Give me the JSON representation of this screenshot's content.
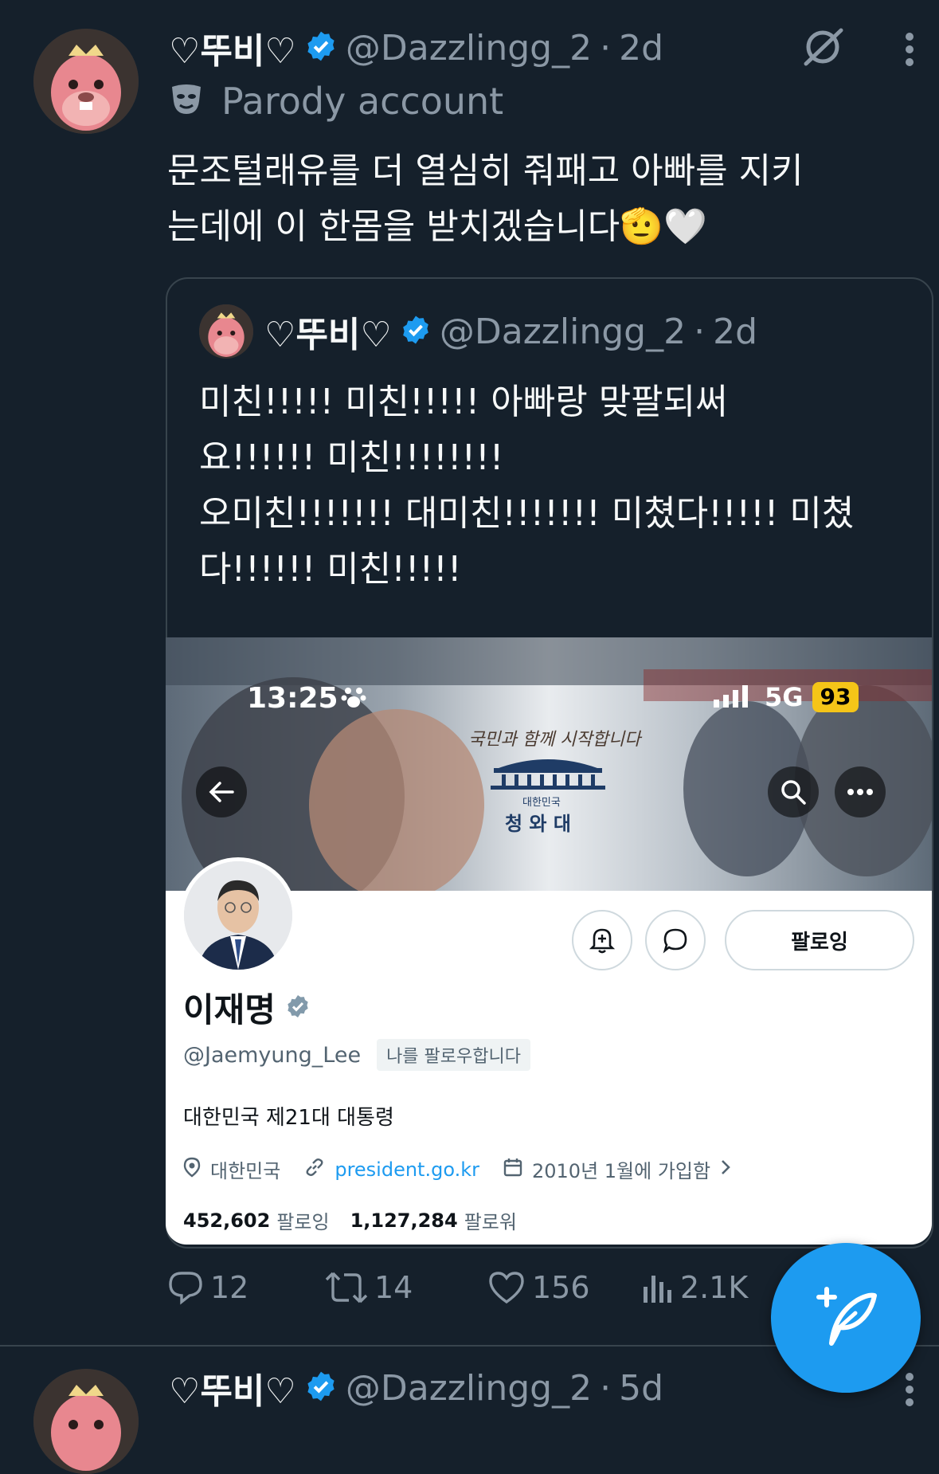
{
  "tweet": {
    "display_name": "♡뚜비♡",
    "handle": "@Dazzlingg_2",
    "separator": "·",
    "time": "2d",
    "parody_label": "Parody account",
    "text_line1": "문조털래유를 더 열심히 줘패고 아빠를 지키",
    "text_line2": "는데에 이 한몸을 받치겠습니다🫡🤍"
  },
  "quote": {
    "display_name": "♡뚜비♡",
    "handle": "@Dazzlingg_2",
    "separator": "·",
    "time": "2d",
    "line1": "미친!!!!! 미친!!!!! 아빠랑 맞팔되써",
    "line2": "요!!!!!! 미친!!!!!!!!",
    "line3": "오미친!!!!!!! 대미친!!!!!!! 미쳤다!!!!! 미쳤",
    "line4": "다!!!!!! 미친!!!!!"
  },
  "screenshot": {
    "status_time": "13:25",
    "network": "5G",
    "battery": "93",
    "banner_slogan": "국민과 함께 시작합니다",
    "banner_country": "대한민국",
    "banner_title": "청 와 대",
    "following_button": "팔로잉",
    "profile_name": "이재명",
    "profile_handle": "@Jaemyung_Lee",
    "follows_you": "나를 팔로우합니다",
    "bio": "대한민국 제21대 대통령",
    "location": "대한민국",
    "website": "president.go.kr",
    "joined": "2010년 1월에 가입함",
    "following_count": "452,602",
    "following_label": "팔로잉",
    "followers_count": "1,127,284",
    "followers_label": "팔로워"
  },
  "actions": {
    "replies": "12",
    "retweets": "14",
    "likes": "156",
    "views": "2.1K"
  },
  "next_tweet": {
    "display_name": "♡뚜비♡",
    "handle": "@Dazzlingg_2",
    "separator": "·",
    "time": "5d"
  },
  "colors": {
    "background": "#15202b",
    "verified": "#1d9bf0",
    "muted": "#8b98a5",
    "fab": "#1d9bf0"
  }
}
